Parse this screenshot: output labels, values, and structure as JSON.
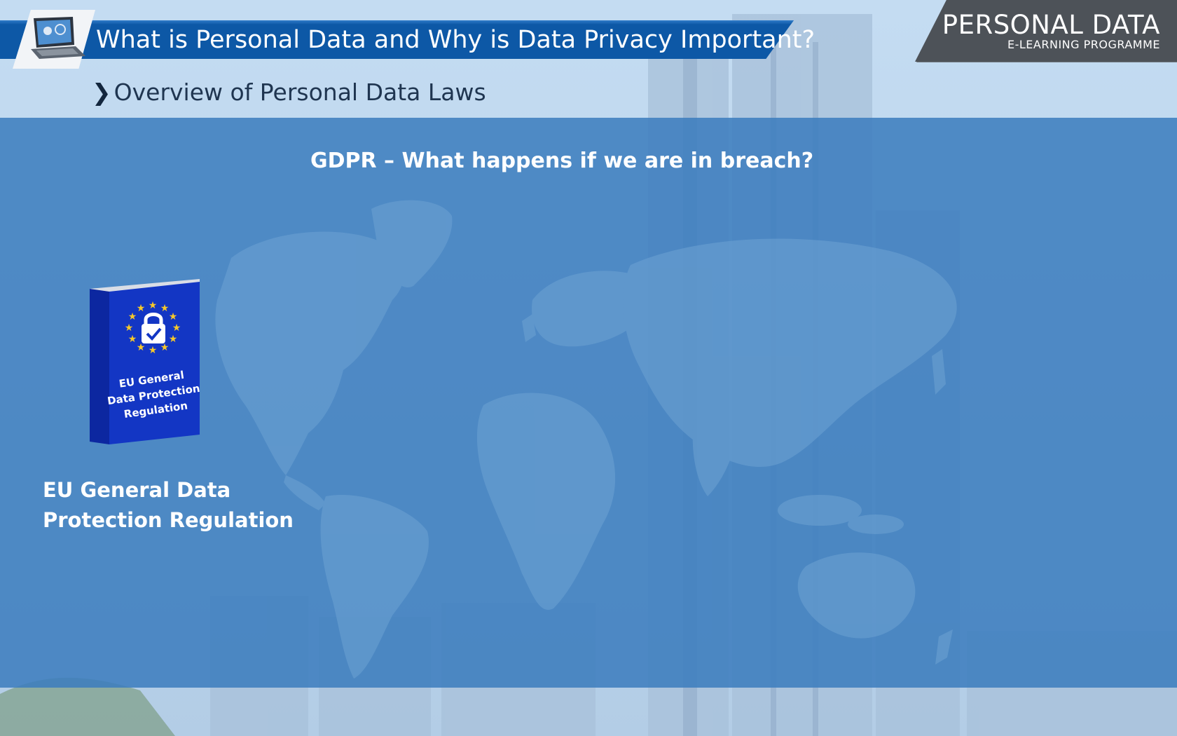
{
  "header": {
    "title": "What is Personal Data and Why is Data Privacy Important?",
    "subtitle_chevron": "❯",
    "subtitle": "Overview of Personal Data Laws"
  },
  "brand": {
    "title": "PERSONAL DATA",
    "subtitle": "E-LEARNING PROGRAMME"
  },
  "main": {
    "heading": "GDPR  – What happens if we are in breach?",
    "book": {
      "cover_lines": [
        "EU General",
        "Data Protection",
        "Regulation"
      ],
      "icon": "padlock-check-icon",
      "star_icon": "eu-star-icon"
    },
    "caption_lines": [
      "EU General Data",
      "Protection Regulation"
    ]
  },
  "colors": {
    "header_blue": "#0d58a6",
    "panel_blue": "#3b7dbe",
    "brand_gray": "#4d5258",
    "book_blue": "#1336c4",
    "star_yellow": "#f6c82a"
  }
}
